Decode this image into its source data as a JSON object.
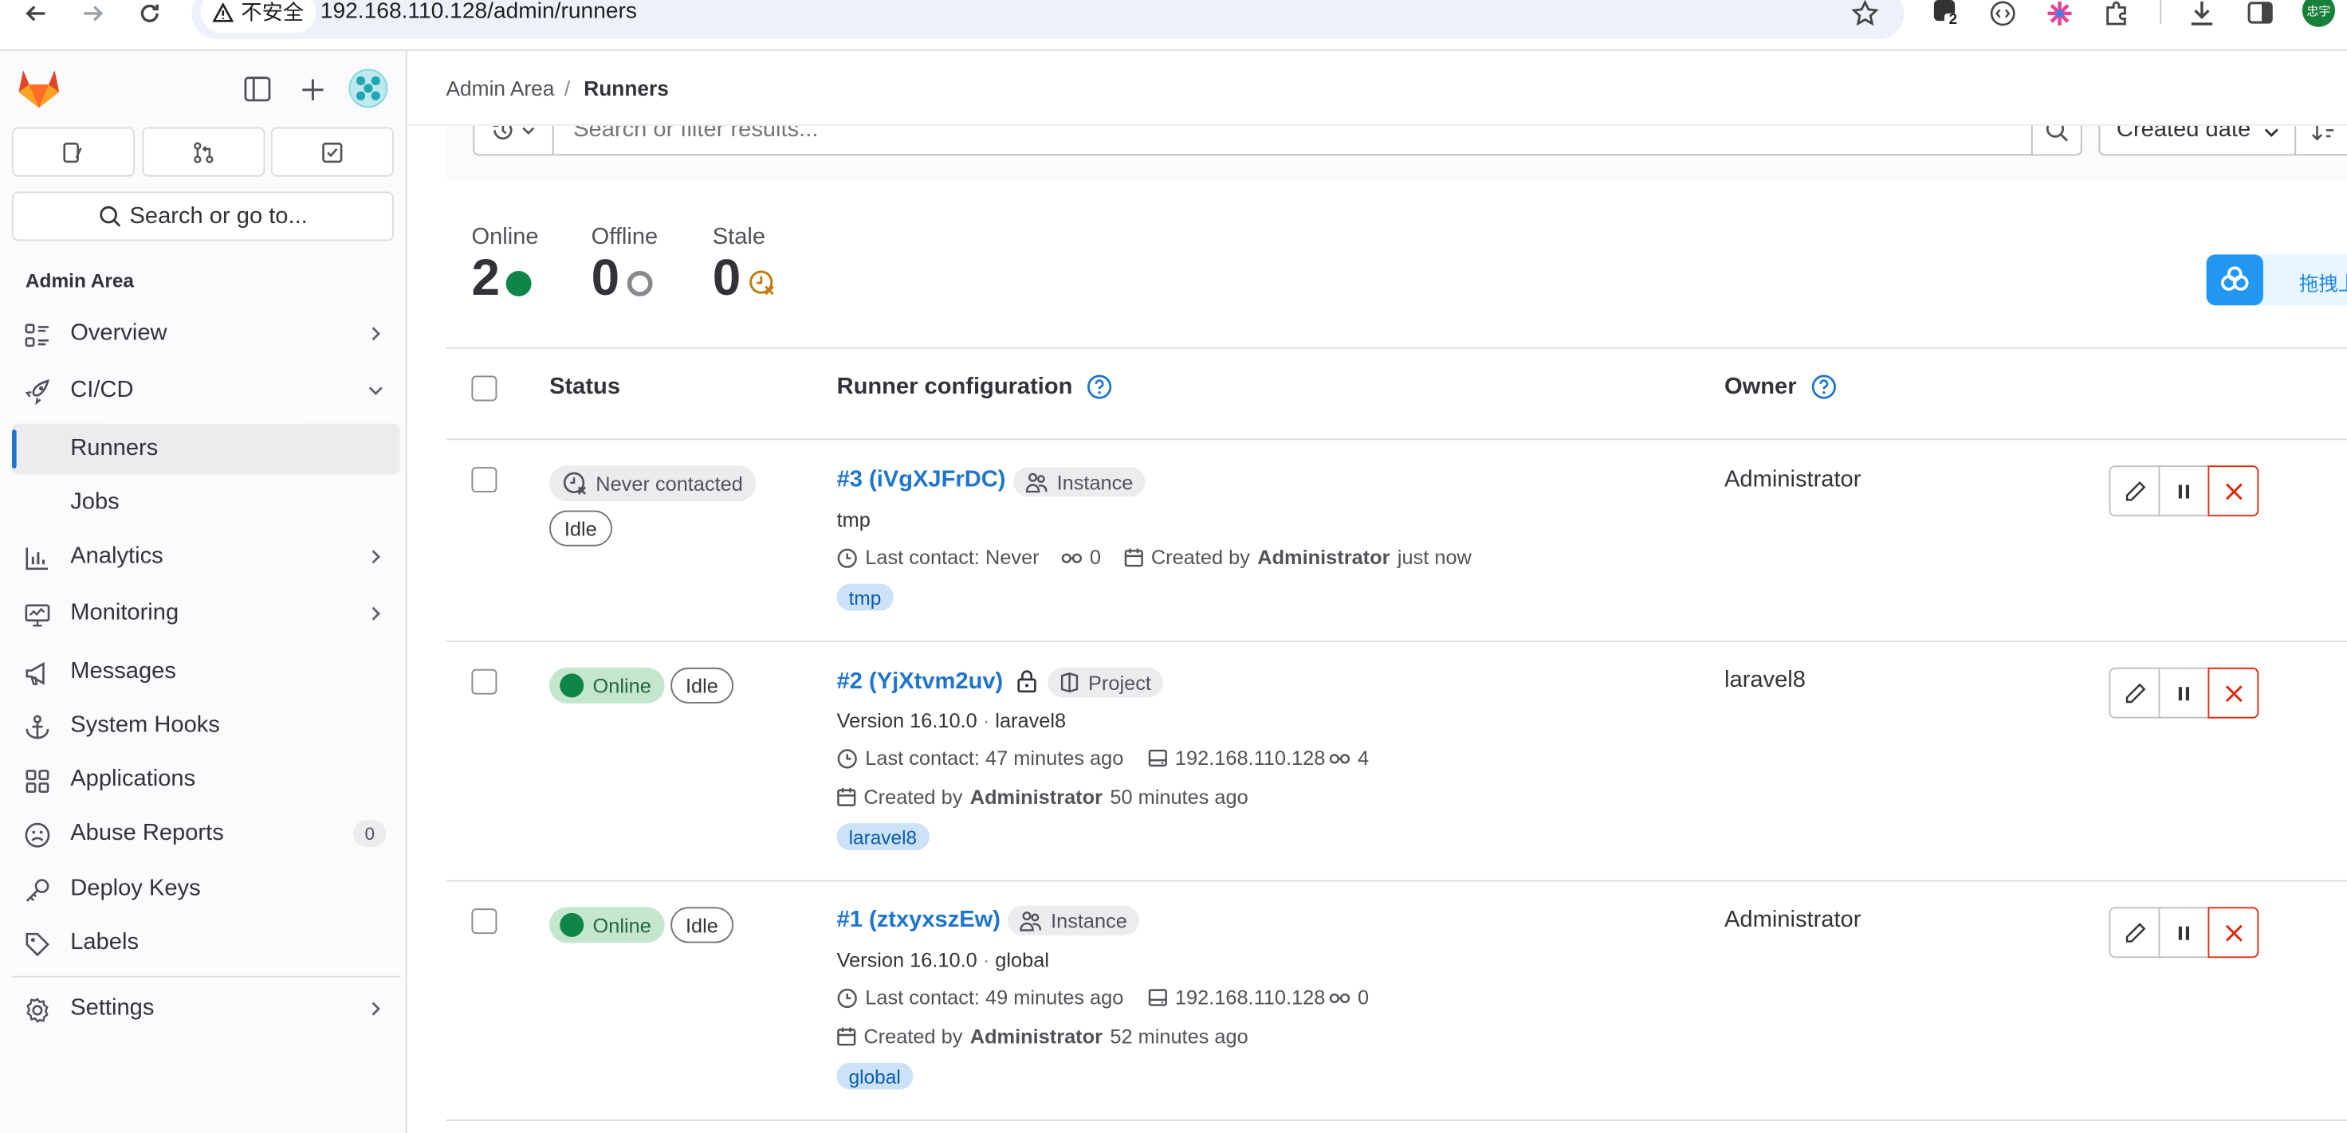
{
  "browser": {
    "security_label": "不安全",
    "url": "192.168.110.128/admin/runners",
    "ext_badge": "2",
    "profile_label": "忠宇"
  },
  "sidebar": {
    "search_label": "Search or go to...",
    "section_title": "Admin Area",
    "items": [
      {
        "label": "Overview",
        "icon": "overview-icon",
        "chevron": "right"
      },
      {
        "label": "CI/CD",
        "icon": "rocket-icon",
        "chevron": "down"
      },
      {
        "label": "Runners",
        "icon": "",
        "active": true
      },
      {
        "label": "Jobs",
        "icon": ""
      },
      {
        "label": "Analytics",
        "icon": "chart-icon",
        "chevron": "right"
      },
      {
        "label": "Monitoring",
        "icon": "monitor-icon",
        "chevron": "right"
      },
      {
        "label": "Messages",
        "icon": "bullhorn-icon"
      },
      {
        "label": "System Hooks",
        "icon": "anchor-icon"
      },
      {
        "label": "Applications",
        "icon": "apps-icon"
      },
      {
        "label": "Abuse Reports",
        "icon": "abuse-icon",
        "count": "0"
      },
      {
        "label": "Deploy Keys",
        "icon": "key-icon"
      },
      {
        "label": "Labels",
        "icon": "label-icon"
      },
      {
        "label": "Settings",
        "icon": "settings-icon",
        "chevron": "right"
      }
    ]
  },
  "breadcrumb": {
    "parent": "Admin Area",
    "separator": "/",
    "current": "Runners"
  },
  "filter": {
    "placeholder": "Search or filter results...",
    "sort_label": "Created date"
  },
  "stats": {
    "online": {
      "label": "Online",
      "value": "2"
    },
    "offline": {
      "label": "Offline",
      "value": "0"
    },
    "stale": {
      "label": "Stale",
      "value": "0"
    }
  },
  "floating_widget": {
    "text": "拖拽上传"
  },
  "table": {
    "headers": {
      "status": "Status",
      "config": "Runner configuration",
      "owner": "Owner"
    },
    "rows": [
      {
        "status": "Never contacted",
        "status_kind": "never",
        "idle": "Idle",
        "title": "#3 (iVgXJFrDC)",
        "locked": false,
        "scope": "Instance",
        "description": "tmp",
        "last_contact": "Last contact: Never",
        "ip": "",
        "jobs": "0",
        "created_prefix": "Created by",
        "created_by": "Administrator",
        "created_when": "just now",
        "tag": "tmp",
        "owner": "Administrator"
      },
      {
        "status": "Online",
        "status_kind": "online",
        "idle": "Idle",
        "title": "#2 (YjXtvm2uv)",
        "locked": true,
        "scope": "Project",
        "version": "Version 16.10.0",
        "description": "laravel8",
        "last_contact": "Last contact: 47 minutes ago",
        "ip": "192.168.110.128",
        "jobs": "4",
        "created_prefix": "Created by",
        "created_by": "Administrator",
        "created_when": "50 minutes ago",
        "tag": "laravel8",
        "owner": "laravel8"
      },
      {
        "status": "Online",
        "status_kind": "online",
        "idle": "Idle",
        "title": "#1 (ztxyxszEw)",
        "locked": false,
        "scope": "Instance",
        "version": "Version 16.10.0",
        "description": "global",
        "last_contact": "Last contact: 49 minutes ago",
        "ip": "192.168.110.128",
        "jobs": "0",
        "created_prefix": "Created by",
        "created_by": "Administrator",
        "created_when": "52 minutes ago",
        "tag": "global",
        "owner": "Administrator"
      }
    ]
  },
  "colors": {
    "link": "#1f75cb",
    "online": "#108548",
    "danger": "#dd2b0e",
    "tag_bg": "#cbe2f9",
    "sidebar_bg": "#fbfafd"
  }
}
